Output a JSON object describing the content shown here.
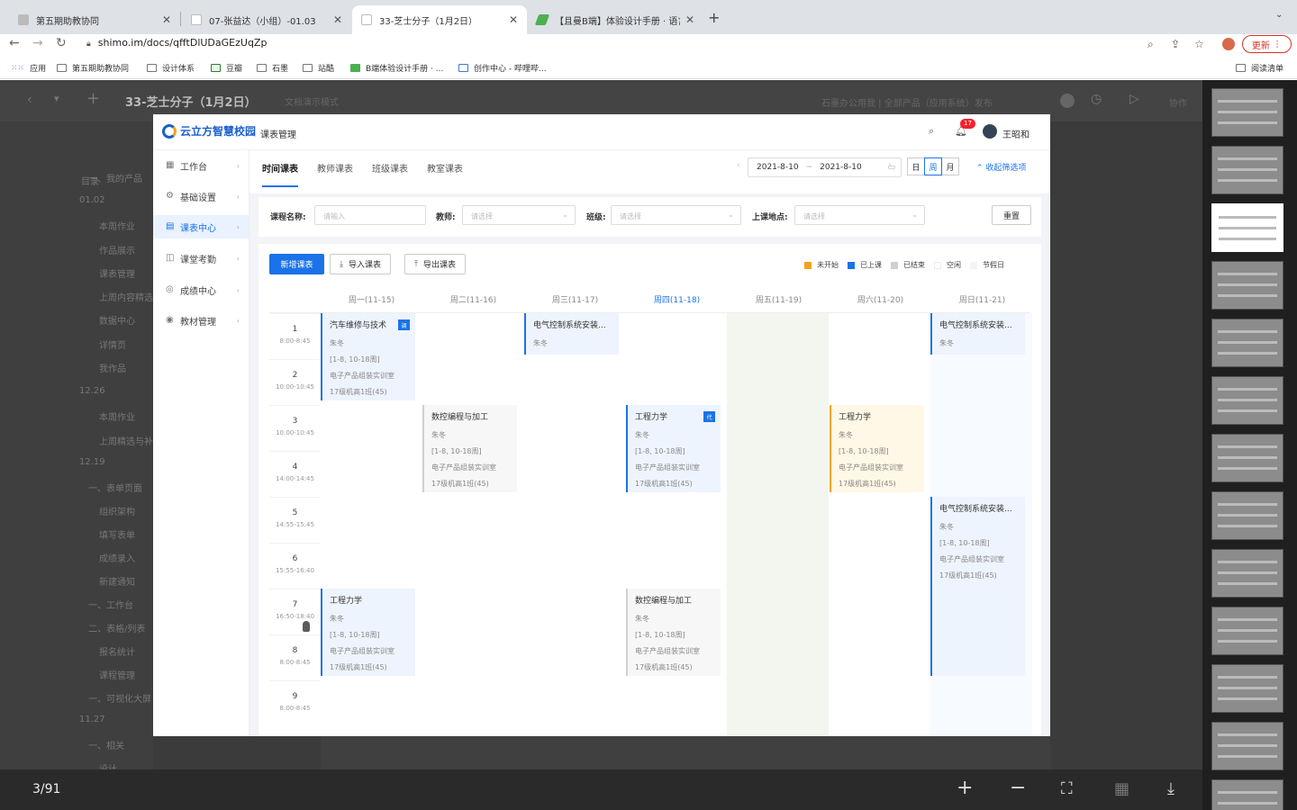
{
  "browser": {
    "tabs": [
      {
        "label": "第五期助教协同"
      },
      {
        "label": "07-张益达（小组）-01.03"
      },
      {
        "label": "33-芝士分子（1月2日）"
      },
      {
        "label": "【且曼B端】体验设计手册 · 语言"
      }
    ],
    "new_tab": "+",
    "url": "shimo.im/docs/qfftDlUDaGEzUqZp",
    "update_label": "更新",
    "bookmarks": [
      "应用",
      "第五期助教协同",
      "设计体系",
      "豆瓣",
      "石墨",
      "站酷",
      "B端体验设计手册 · ...",
      "创作中心 - 哔哩哔..."
    ],
    "reading_list": "阅读清单"
  },
  "viewer": {
    "doc_title": "33-芝士分子（1月2日）",
    "doc_hint": "文档演示模式",
    "publish_note": "石墨办公用我 | 全部产品（应用系统）发布",
    "collab_label": "协作",
    "outline_title": "目录",
    "outline": [
      "一、我的产品",
      "01.02",
      "本周作业",
      "作品展示",
      "课表管理",
      "上周内容精选",
      "数据中心",
      "详情页",
      "我作品",
      "12.26",
      "本周作业",
      "上周精选与补充",
      "12.19",
      "一、表单页面",
      "组织架构",
      "填写表单",
      "成绩录入",
      "新建通知",
      "一、工作台",
      "二、表格/列表",
      "报名统计",
      "课程管理",
      "一、可视化大屏",
      "11.27",
      "一、相关",
      "设计"
    ],
    "page_count": "3/91"
  },
  "app": {
    "logo_text": "云立方智慧校园",
    "module": "课表管理",
    "notification_count": "17",
    "user_name": "王昭和",
    "nav": [
      {
        "label": "工作台",
        "icon": "▦"
      },
      {
        "label": "基础设置",
        "icon": "⚙"
      },
      {
        "label": "课表中心",
        "icon": "▤"
      },
      {
        "label": "课堂考勤",
        "icon": "◫"
      },
      {
        "label": "成绩中心",
        "icon": "◎"
      },
      {
        "label": "教材管理",
        "icon": "◉"
      }
    ],
    "tabs": [
      "时间课表",
      "教师课表",
      "班级课表",
      "教室课表"
    ],
    "date_start": "2021-8-10",
    "date_end": "2021-8-10",
    "date_sep": "~",
    "views": [
      "日",
      "周",
      "月"
    ],
    "collapse_label": "收起筛选项",
    "filters": {
      "course_label": "课程名称:",
      "course_placeholder": "请输入",
      "teacher_label": "教师:",
      "teacher_placeholder": "请选择",
      "class_label": "班级:",
      "class_placeholder": "请选择",
      "location_label": "上课地点:",
      "location_placeholder": "请选择",
      "reset": "重置"
    },
    "actions": {
      "new": "新增课表",
      "import": "导入课表",
      "export": "导出课表"
    },
    "legend": [
      {
        "label": "未开始",
        "color": "#f4a21d"
      },
      {
        "label": "已上课",
        "color": "#1a73e8"
      },
      {
        "label": "已结束",
        "color": "#d0d0d0"
      },
      {
        "label": "空闲",
        "color": "#ffffff"
      },
      {
        "label": "节假日",
        "color": "#f3f6ee"
      }
    ],
    "days": [
      "周一(11-15)",
      "周二(11-16)",
      "周三(11-17)",
      "周四(11-18)",
      "周五(11-19)",
      "周六(11-20)",
      "周日(11-21)"
    ],
    "slots": [
      {
        "n": "1",
        "t": "8:00-8:45"
      },
      {
        "n": "2",
        "t": "10:00-10:45"
      },
      {
        "n": "3",
        "t": "10:00-10:45"
      },
      {
        "n": "4",
        "t": "14:00-14:45"
      },
      {
        "n": "5",
        "t": "14:55-15:45"
      },
      {
        "n": "6",
        "t": "15:55-16:40"
      },
      {
        "n": "7",
        "t": "16:50-18:40"
      },
      {
        "n": "8",
        "t": "8:00-8:45"
      },
      {
        "n": "9",
        "t": "8:00-8:45"
      }
    ],
    "courses": [
      {
        "name": "汽车维修与技术",
        "teacher": "朱冬",
        "weeks": "[1-8, 10-18周]",
        "room": "电子产品组装实训室",
        "class": "17级机高1班(45)",
        "tag": "调"
      },
      {
        "name": "电气控制系统安装...",
        "teacher": "朱冬",
        "weeks": "",
        "room": "",
        "class": "",
        "tag": ""
      },
      {
        "name": "电气控制系统安装...",
        "teacher": "朱冬",
        "weeks": "",
        "room": "",
        "class": "",
        "tag": ""
      },
      {
        "name": "数控编程与加工",
        "teacher": "朱冬",
        "weeks": "[1-8, 10-18周]",
        "room": "电子产品组装实训室",
        "class": "17级机高1班(45)",
        "tag": ""
      },
      {
        "name": "工程力学",
        "teacher": "朱冬",
        "weeks": "[1-8, 10-18周]",
        "room": "电子产品组装实训室",
        "class": "17级机高1班(45)",
        "tag": "代"
      },
      {
        "name": "工程力学",
        "teacher": "朱冬",
        "weeks": "[1-8, 10-18周]",
        "room": "电子产品组装实训室",
        "class": "17级机高1班(45)",
        "tag": ""
      },
      {
        "name": "电气控制系统安装...",
        "teacher": "朱冬",
        "weeks": "[1-8, 10-18周]",
        "room": "电子产品组装实训室",
        "class": "17级机高1班(45)",
        "tag": ""
      },
      {
        "name": "工程力学",
        "teacher": "朱冬",
        "weeks": "[1-8, 10-18周]",
        "room": "电子产品组装实训室",
        "class": "17级机高1班(45)",
        "tag": ""
      },
      {
        "name": "数控编程与加工",
        "teacher": "朱冬",
        "weeks": "[1-8, 10-18周]",
        "room": "电子产品组装实训室",
        "class": "17级机高1班(45)",
        "tag": ""
      }
    ]
  }
}
